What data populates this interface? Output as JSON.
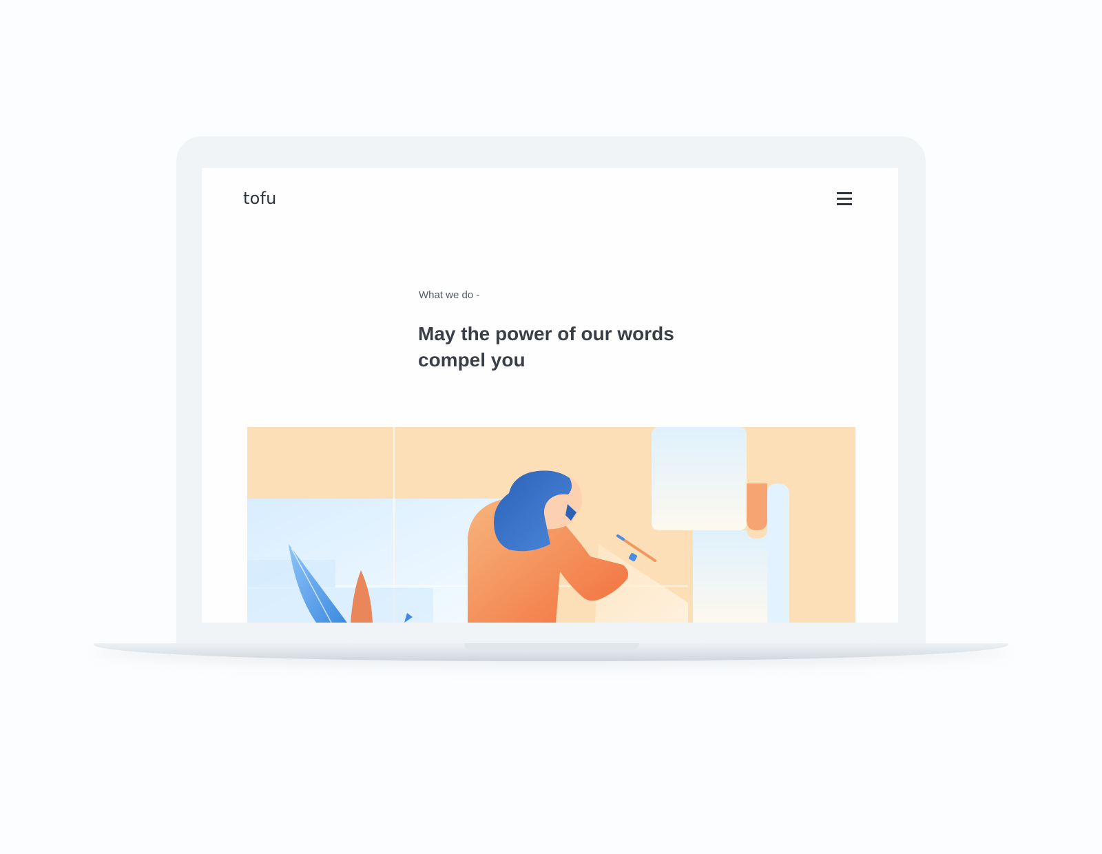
{
  "header": {
    "logo": "tofu",
    "menu_icon": "hamburger-menu-icon"
  },
  "hero": {
    "eyebrow": "What we do -",
    "headline": "May the power of our words compel you"
  },
  "illustration": {
    "subject": "woman-writing-icon"
  },
  "colors": {
    "background": "#fcfdfe",
    "laptop": "#f1f4f7",
    "text_dark": "#3a3f47",
    "peach": "#fddfb7",
    "sky": "#dcefff",
    "orange": "#f58a54",
    "blue": "#2f6fc5"
  }
}
